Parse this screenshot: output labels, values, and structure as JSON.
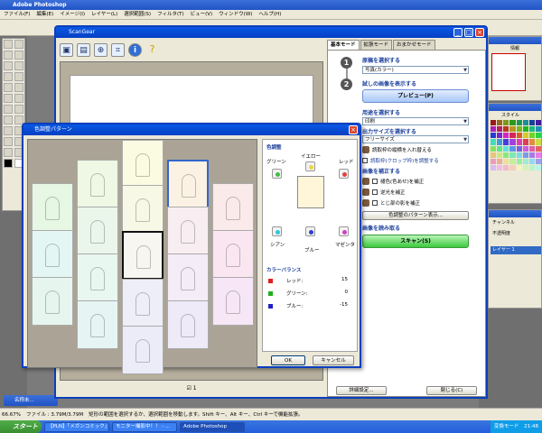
{
  "photoshop": {
    "title": "Adobe Photoshop",
    "menu": [
      "ファイル(F)",
      "編集(E)",
      "イメージ(I)",
      "レイヤー(L)",
      "選択範囲(S)",
      "フィルタ(T)",
      "ビュー(V)",
      "ウィンドウ(W)",
      "ヘルプ(H)"
    ],
    "navigator_tab": "ナビゲー",
    "navigator_label": "情報",
    "swatches_label": "スタイル",
    "layers_tabs": "チャンネル",
    "layer_mode": "不透明度",
    "layer_name": "レイヤー 1",
    "status_zoom": "66.67%",
    "status_doc": "ファイル : 3.79M/3.79M",
    "status_hint": "矩形の範囲を選択するか、選択範囲を移動します。Shift キー、Alt キー、Ctrl キーで機能拡張。",
    "mini_window": "名称未...",
    "colors": {
      "accent": "#0a58e4",
      "taskbar": "#245edb",
      "start": "#3a8f33"
    }
  },
  "taskbar": {
    "start_label": "スタート",
    "tasks": [
      "【PLN】「メガンコミック」...",
      "モニター撮影中！！ - ...",
      "Adobe Photoshop"
    ],
    "ime": "変換モード",
    "clock": "21:48"
  },
  "scangear": {
    "title": "ScanGear",
    "toolbar_icons": [
      "scan-preview-icon",
      "monitor-icon",
      "zoom-icon",
      "crop-icon",
      "info-icon",
      "help-icon"
    ],
    "preview_page": "1",
    "tabs": [
      "基本モード",
      "拡張モード",
      "おまかせモード"
    ],
    "active_tab": 0,
    "step1": {
      "title": "原稿を選択する",
      "select": "写真(カラー)"
    },
    "step2": {
      "title": "試しの画像を表示する",
      "button": "プレビュー(P)"
    },
    "step3": {
      "title": "用途を選択する",
      "select": "印刷"
    },
    "step4": {
      "title": "出力サイズを選択する",
      "select": "フリーサイズ"
    },
    "checkboxes": [
      "読取枠の縦横を入れ替える",
      "読取枠(クロップ枠)を調整する"
    ],
    "step5": {
      "title": "画像を補正する"
    },
    "corrections": [
      "褪色(色あせ)を補正",
      "逆光を補正",
      "とじ部の影を補正"
    ],
    "pattern_button": "色調整のパターン表示...",
    "step6": {
      "title": "画像を読み取る",
      "button": "スキャン(S)"
    },
    "footer": {
      "prefs": "詳細設定...",
      "close": "閉じる(C)"
    }
  },
  "dialog": {
    "title": "色調整パターン",
    "section_color": "色調整",
    "yellow": "イエロー",
    "green": "グリーン",
    "red": "レッド",
    "cyan": "シアン",
    "blue": "ブルー",
    "magenta": "マゼンタ",
    "section_balance": "カラーバランス",
    "balance": [
      {
        "name": "レッド:",
        "value": "15",
        "color": "#e02020"
      },
      {
        "name": "グリーン:",
        "value": "0",
        "color": "#20b020"
      },
      {
        "name": "ブルー:",
        "value": "-15",
        "color": "#2020c0"
      }
    ],
    "ok": "OK",
    "cancel": "キャンセル"
  }
}
